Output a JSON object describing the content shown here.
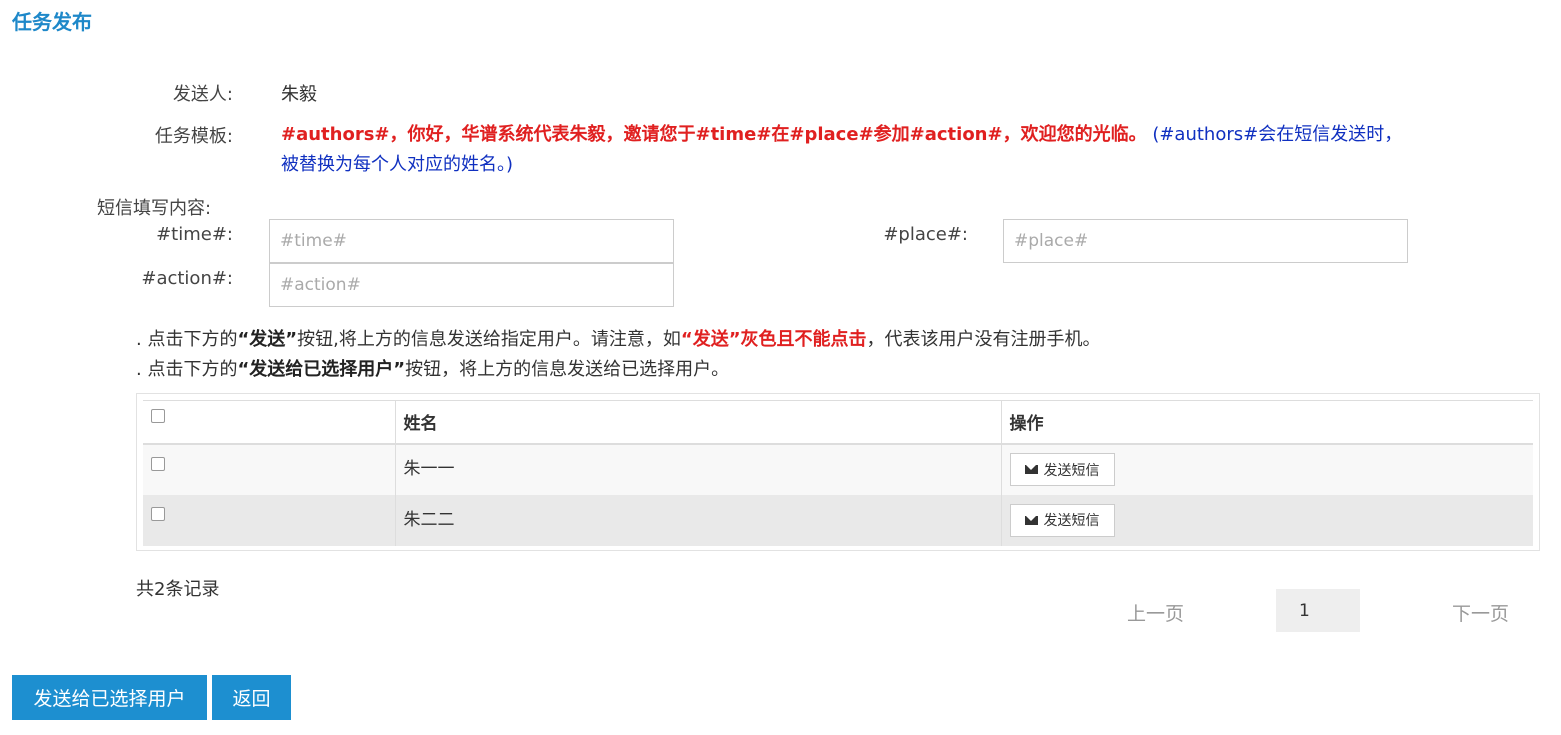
{
  "page": {
    "title": "任务发布"
  },
  "sender": {
    "label": "发送人:",
    "value": "朱毅"
  },
  "template": {
    "label": "任务模板:",
    "text_red": "#authors#，你好，华谱系统代表朱毅，邀请您于#time#在#place#参加#action#，欢迎您的光临。",
    "text_blue": " (#authors#会在短信发送时，被替换为每个人对应的姓名。)"
  },
  "sms": {
    "section_label": "短信填写内容:",
    "time": {
      "label": "#time#:",
      "placeholder": "#time#"
    },
    "place": {
      "label": "#place#:",
      "placeholder": "#place#"
    },
    "action": {
      "label": "#action#:",
      "placeholder": "#action#"
    }
  },
  "notes": {
    "line1": {
      "prefix": ". 点击下方的",
      "bold1": "“发送”",
      "mid": "按钮,将上方的信息发送给指定用户。请注意，如",
      "red": "“发送”灰色且不能点击",
      "suffix": "，代表该用户没有注册手机。"
    },
    "line2": {
      "prefix": ". 点击下方的",
      "bold1": "“发送给已选择用户”",
      "suffix": "按钮，将上方的信息发送给已选择用户。"
    }
  },
  "table": {
    "headers": {
      "name": "姓名",
      "action": "操作"
    },
    "rows": [
      {
        "name": "朱一一",
        "button": "发送短信"
      },
      {
        "name": "朱二二",
        "button": "发送短信"
      }
    ]
  },
  "pagination": {
    "total": "共2条记录",
    "prev": "上一页",
    "page": "1",
    "next": "下一页"
  },
  "buttons": {
    "send_selected": "发送给已选择用户",
    "back": "返回"
  },
  "colors": {
    "accent": "#1d8fd0",
    "warning": "#e02020",
    "note_blue": "#1030c0"
  }
}
